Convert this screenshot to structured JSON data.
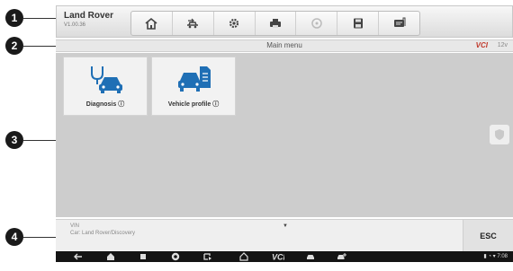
{
  "callouts": [
    "1",
    "2",
    "3",
    "4"
  ],
  "header": {
    "app_name": "Land Rover",
    "version": "V1.00.36",
    "toolbar_icons": [
      "home-icon",
      "vehicle-swap-icon",
      "settings-icon",
      "print-icon",
      "help-icon",
      "save-icon",
      "data-log-icon"
    ]
  },
  "titlebar": {
    "title": "Main menu",
    "vci_logo": "VCI",
    "battery": "12v"
  },
  "main": {
    "tiles": [
      {
        "label": "Diagnosis",
        "icon": "diagnosis-car-stethoscope-icon"
      },
      {
        "label": "Vehicle profile",
        "icon": "vehicle-profile-icon"
      }
    ]
  },
  "infobar": {
    "line1": "VIN",
    "line2": "Car: Land Rover/Discovery",
    "esc_label": "ESC"
  },
  "navbar": {
    "icons": [
      "back-icon",
      "home-icon",
      "recent-apps-icon",
      "chrome-icon",
      "screenshot-icon",
      "maxisys-home-icon",
      "vci-icon",
      "car-icon",
      "car-service-icon"
    ],
    "status": "7:08"
  },
  "colors": {
    "accent_blue": "#1f6fb5",
    "vci_red": "#c0392b",
    "main_bg": "#cdcdcd",
    "navbar_bg": "#141414"
  }
}
